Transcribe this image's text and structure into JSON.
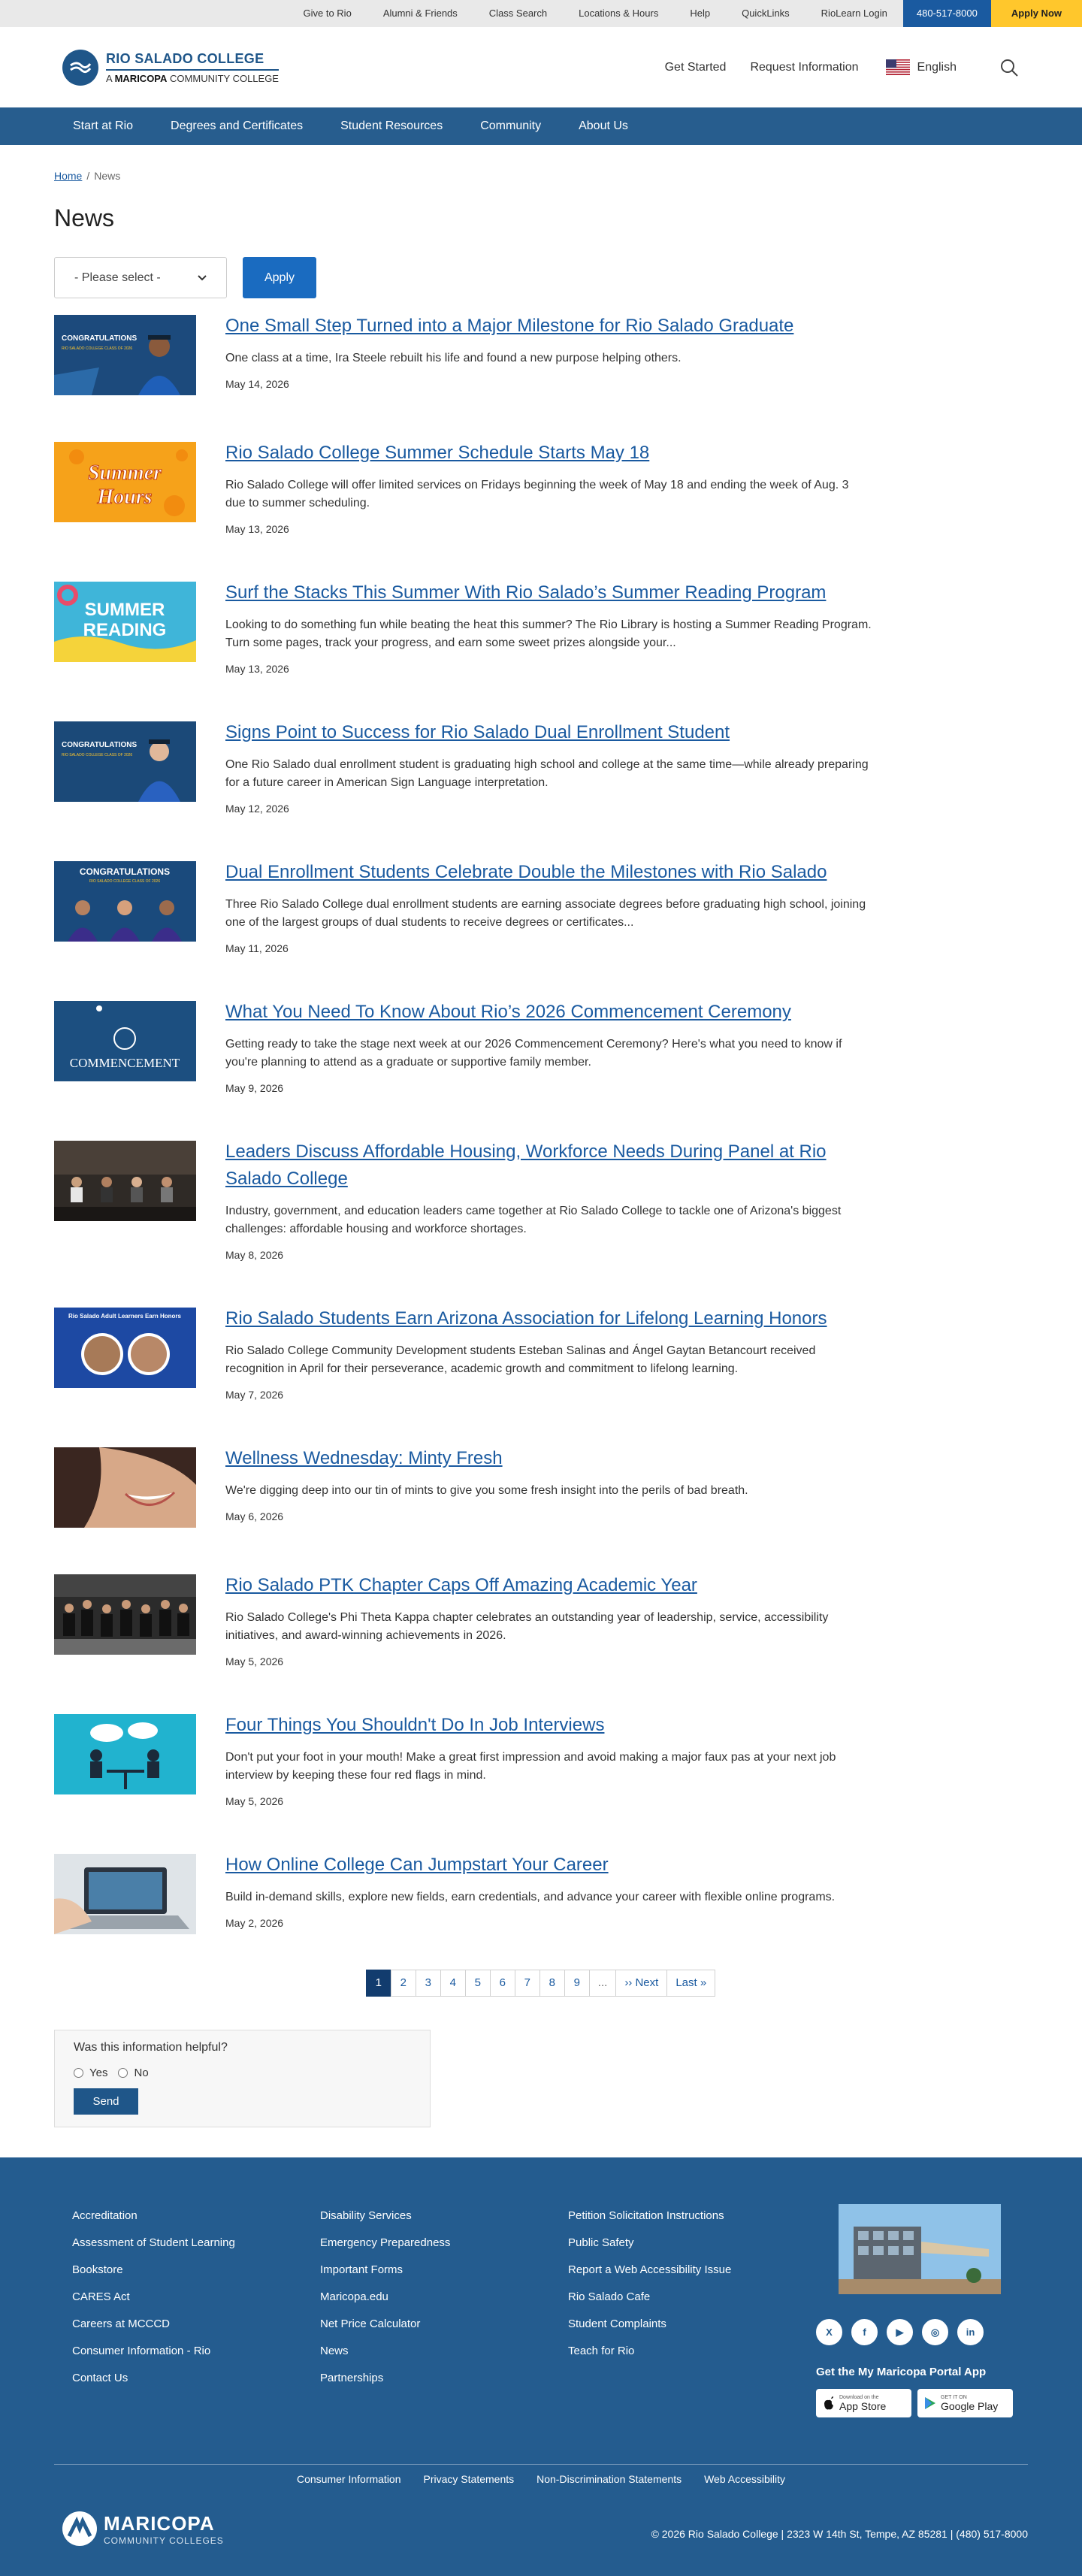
{
  "utility": {
    "links": [
      "Give to Rio",
      "Alumni & Friends",
      "Class Search",
      "Locations & Hours",
      "Help",
      "QuickLinks",
      "RioLearn Login"
    ],
    "phone": "480-517-8000",
    "apply": "Apply Now"
  },
  "header": {
    "brand_top": "RIO SALADO COLLEGE",
    "brand_prefix": "A",
    "brand_bold": "MARICOPA",
    "brand_suffix": "COMMUNITY COLLEGE",
    "get_started": "Get Started",
    "request_info": "Request Information",
    "language": "English"
  },
  "nav": [
    "Start at Rio",
    "Degrees and Certificates",
    "Student Resources",
    "Community",
    "About Us"
  ],
  "breadcrumb": {
    "home": "Home",
    "sep": "/",
    "current": "News"
  },
  "page": {
    "title": "News",
    "select_value": "- Please select -",
    "apply_label": "Apply"
  },
  "news": [
    {
      "title": "One Small Step Turned into a Major Milestone for Rio Salado Graduate",
      "summary": "One class at a time, Ira Steele rebuilt his life and found a new purpose helping others.",
      "date": "May 14, 2026"
    },
    {
      "title": "Rio Salado College Summer Schedule Starts May 18",
      "summary": "Rio Salado College will offer limited services on Fridays beginning the week of May 18 and ending the week of Aug. 3 due to summer scheduling.",
      "date": "May 13, 2026"
    },
    {
      "title": "Surf the Stacks This Summer With Rio Salado’s Summer Reading Program",
      "summary": "Looking to do something fun while beating the heat this summer? The Rio Library is hosting a Summer Reading Program. Turn some pages, track your progress, and earn some sweet prizes alongside your...",
      "date": "May 13, 2026"
    },
    {
      "title": "Signs Point to Success for Rio Salado Dual Enrollment Student",
      "summary": "One Rio Salado dual enrollment student is graduating high school and college at the same time—while already preparing for a future career in American Sign Language interpretation.",
      "date": "May 12, 2026"
    },
    {
      "title": "Dual Enrollment Students Celebrate Double the Milestones with Rio Salado",
      "summary": "Three Rio Salado College dual enrollment students are earning associate degrees before graduating high school, joining one of the largest groups of dual students to receive degrees or certificates...",
      "date": "May 11, 2026"
    },
    {
      "title": "What You Need To Know About Rio’s 2026 Commencement Ceremony",
      "summary": "Getting ready to take the stage next week at our 2026 Commencement Ceremony? Here's what you need to know if you're planning to attend as a graduate or supportive family member.",
      "date": "May 9, 2026"
    },
    {
      "title": "Leaders Discuss Affordable Housing, Workforce Needs During Panel at Rio Salado College",
      "summary": "Industry, government, and education leaders came together at Rio Salado College to tackle one of Arizona's biggest challenges: affordable housing and workforce shortages.",
      "date": "May 8, 2026"
    },
    {
      "title": "Rio Salado Students Earn Arizona Association for Lifelong Learning Honors",
      "summary": "Rio Salado College Community Development students Esteban Salinas and Ángel Gaytan Betancourt received recognition in April for their perseverance, academic growth and commitment to lifelong learning.",
      "date": "May 7, 2026"
    },
    {
      "title": "Wellness Wednesday: Minty Fresh",
      "summary": "We're digging deep into our tin of mints to give you some fresh insight into the perils of bad breath.",
      "date": "May 6, 2026"
    },
    {
      "title": "Rio Salado PTK Chapter Caps Off Amazing Academic Year",
      "summary": "Rio Salado College's Phi Theta Kappa chapter celebrates an outstanding year of leadership, service, accessibility initiatives, and award-winning achievements in 2026.",
      "date": "May 5, 2026"
    },
    {
      "title": "Four Things You Shouldn't Do In Job Interviews",
      "summary": "Don't put your foot in your mouth! Make a great first impression and avoid making a major faux pas at your next job interview by keeping these four red flags in mind.",
      "date": "May 5, 2026"
    },
    {
      "title": "How Online College Can Jumpstart Your Career",
      "summary": "Build in-demand skills, explore new fields, earn credentials, and advance your career with flexible online programs.",
      "date": "May 2, 2026"
    }
  ],
  "thumb_text": {
    "congrats": "CONGRATULATIONS",
    "rsc_class": "RIO SALADO COLLEGE CLASS OF 2026",
    "summer": "Summer",
    "hours": "Hours",
    "summer_caps": "SUMMER",
    "reading": "READING",
    "commencement": "COMMENCEMENT",
    "adult_learners": "Rio Salado Adult Learners Earn Honors"
  },
  "pagination": [
    "1",
    "2",
    "3",
    "4",
    "5",
    "6",
    "7",
    "8",
    "9",
    "...",
    "›› Next",
    "Last »"
  ],
  "feedback": {
    "question": "Was this information helpful?",
    "yes": "Yes",
    "no": "No",
    "send": "Send"
  },
  "footer": {
    "col1": [
      "Accreditation",
      "Assessment of Student Learning",
      "Bookstore",
      "CARES Act",
      "Careers at MCCCD",
      "Consumer Information - Rio",
      "Contact Us"
    ],
    "col2": [
      "Disability Services",
      "Emergency Preparedness",
      "Important Forms",
      "Maricopa.edu",
      "Net Price Calculator",
      "News",
      "Partnerships"
    ],
    "col3": [
      "Petition Solicitation Instructions",
      "Public Safety",
      "Report a Web Accessibility Issue",
      "Rio Salado Cafe",
      "Student Complaints",
      "Teach for Rio"
    ],
    "social": [
      "x-icon",
      "facebook-icon",
      "youtube-icon",
      "instagram-icon",
      "linkedin-icon"
    ],
    "app_title": "Get the My Maricopa Portal App",
    "app_store_small": "Download on the",
    "app_store": "App Store",
    "google_small": "GET IT ON",
    "google": "Google Play",
    "legal": [
      "Consumer Information",
      "Privacy Statements",
      "Non-Discrimination Statements",
      "Web Accessibility"
    ],
    "maricopa": "MARICOPA",
    "maricopa_sub": "COMMUNITY COLLEGES",
    "copyright": "© 2026 Rio Salado College | 2323 W 14th St, Tempe, AZ 85281 | (480) 517-8000"
  },
  "colors": {
    "brand_blue": "#245c8f",
    "link_blue": "#1a5aa0",
    "apply_yellow": "#ffc72c",
    "button_blue": "#1a6bc0"
  }
}
